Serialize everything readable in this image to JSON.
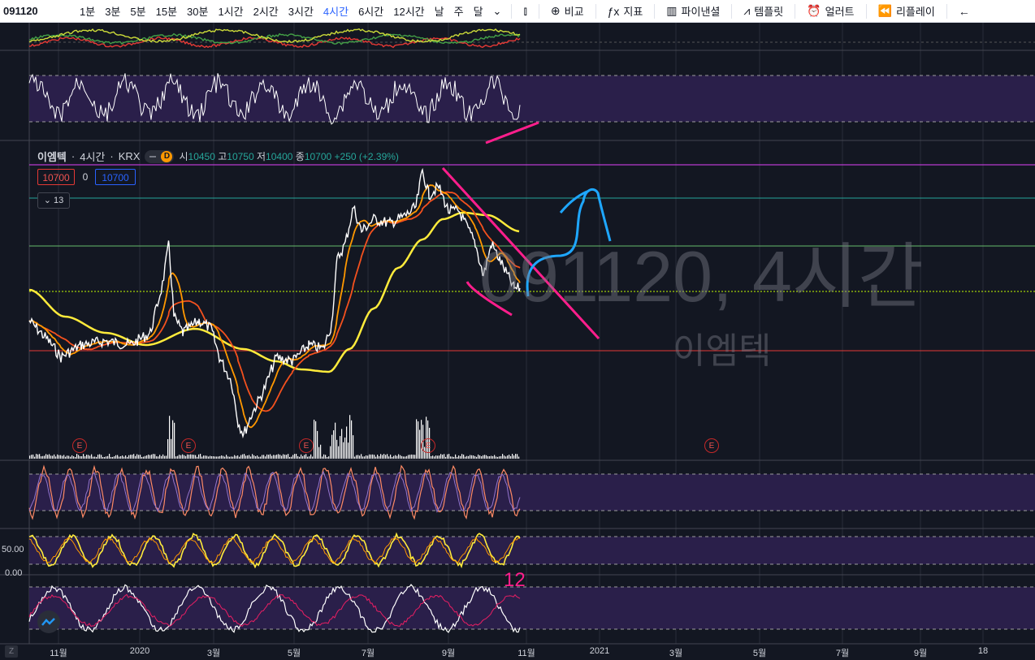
{
  "toolbar": {
    "symbol": "091120",
    "intervals": [
      "1분",
      "3분",
      "5분",
      "15분",
      "30분",
      "1시간",
      "2시간",
      "3시간",
      "4시간",
      "6시간",
      "12시간",
      "날",
      "주",
      "달"
    ],
    "active_interval": "4시간",
    "compare_label": "비교",
    "indicators_label": "지표",
    "pine_label": "파이낸셜",
    "templates_label": "템플릿",
    "alert_label": "얼러트",
    "replay_label": "리플레이"
  },
  "legend": {
    "name": "이엠텍",
    "interval": "4시간",
    "exchange": "KRX",
    "badge": "D",
    "open_label": "시",
    "open": "10450",
    "high_label": "고",
    "high": "10750",
    "low_label": "저",
    "low": "10400",
    "close_label": "종",
    "close": "10700",
    "change": "+250 (+2.39%)"
  },
  "price_boxes": {
    "left": "10700",
    "middle": "0",
    "right": "10700"
  },
  "collapse_count": "13",
  "watermark": {
    "symbol": "091120, 4시간",
    "name": "이엠텍"
  },
  "axis_labels": {
    "level_50": "50.00",
    "level_0": "0.00"
  },
  "x_axis": [
    "11월",
    "2020",
    "3월",
    "5월",
    "7월",
    "9월",
    "11월",
    "2021",
    "3월",
    "5월",
    "7월",
    "9월",
    "18"
  ],
  "earnings_badge": "E",
  "z_button": "Z",
  "annotation_text": "12",
  "colors": {
    "background": "#131722",
    "rsi_band": "#2a1f4a",
    "ma_yellow": "#ffeb3b",
    "ma_orange": "#ff9800",
    "ma_red": "#f44336",
    "drawing_pink": "#ff1e8c",
    "drawing_blue": "#1ea7ff",
    "accent": "#2962ff"
  }
}
